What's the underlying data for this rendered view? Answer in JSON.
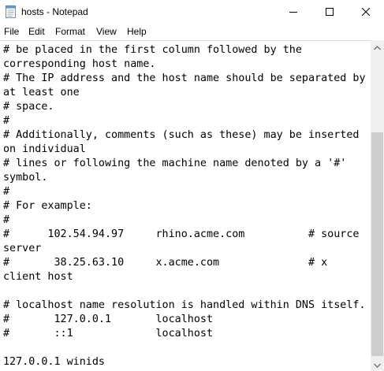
{
  "window": {
    "title": "hosts - Notepad"
  },
  "icons": {
    "app": "notepad-icon",
    "minimize": "minimize-icon",
    "maximize": "maximize-icon",
    "close": "close-icon",
    "scroll_up": "scroll-up-arrow-icon",
    "scroll_down": "scroll-down-arrow-icon"
  },
  "menu": {
    "file": "File",
    "edit": "Edit",
    "format": "Format",
    "view": "View",
    "help": "Help"
  },
  "editor": {
    "lines": [
      "# be placed in the first column followed by the",
      "corresponding host name.",
      "# The IP address and the host name should be separated by",
      "at least one",
      "# space.",
      "#",
      "# Additionally, comments (such as these) may be inserted",
      "on individual",
      "# lines or following the machine name denoted by a '#'",
      "symbol.",
      "#",
      "# For example:",
      "#",
      "#      102.54.94.97     rhino.acme.com          # source",
      "server",
      "#       38.25.63.10     x.acme.com              # x",
      "client host",
      "",
      "# localhost name resolution is handled within DNS itself.",
      "#       127.0.0.1       localhost",
      "#       ::1             localhost",
      "",
      "127.0.0.1 winids"
    ]
  },
  "scrollbar": {
    "position_fraction": 0.3,
    "visible_fraction": 0.74
  },
  "colors": {
    "background": "#ffffff",
    "text": "#000000",
    "scrollbar_track": "#f0f0f0",
    "scrollbar_thumb": "#cdcdcd"
  }
}
